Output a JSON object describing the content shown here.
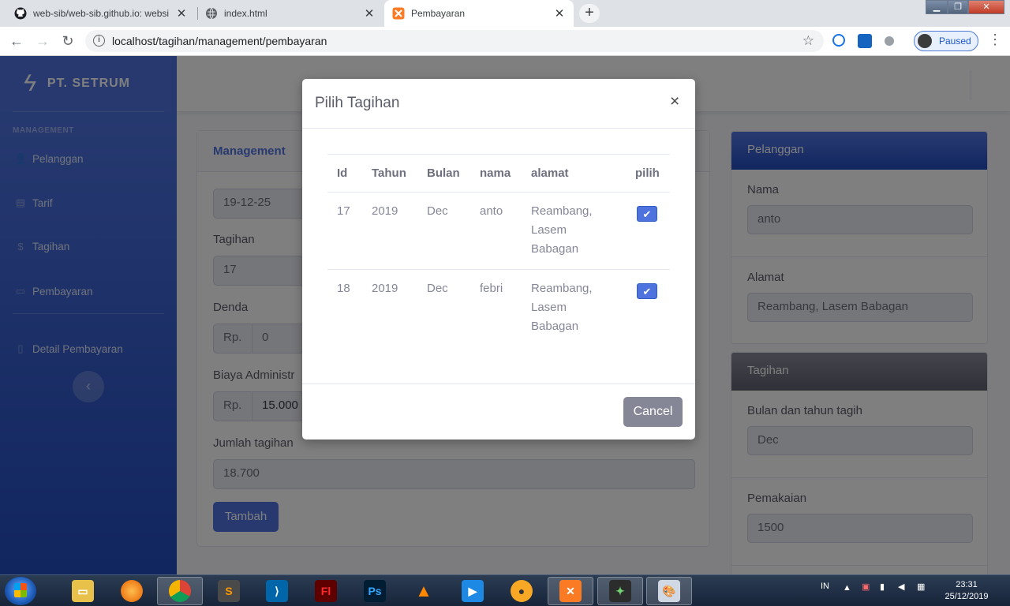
{
  "browser": {
    "tabs": [
      {
        "title": "web-sib/web-sib.github.io: websi",
        "icon": "github-icon"
      },
      {
        "title": "index.html",
        "icon": "globe-icon"
      },
      {
        "title": "Pembayaran",
        "icon": "xampp-icon"
      }
    ],
    "url": "localhost/tagihan/management/pembayaran",
    "profile_status": "Paused"
  },
  "sidebar": {
    "brand": "PT. SETRUM",
    "heading": "MANAGEMENT",
    "items": [
      {
        "label": "Pelanggan",
        "icon": "user-icon"
      },
      {
        "label": "Tarif",
        "icon": "clipboard-icon"
      },
      {
        "label": "Tagihan",
        "icon": "dollar-icon"
      },
      {
        "label": "Pembayaran",
        "icon": "money-icon"
      },
      {
        "label": "Detail Pembayaran",
        "icon": "file-icon"
      }
    ]
  },
  "main_card": {
    "title": "Management",
    "date_value": "19-12-25",
    "tagihan_label": "Tagihan",
    "tagihan_value": "17",
    "denda_label": "Denda",
    "denda_prefix": "Rp.",
    "denda_value": "0",
    "biaya_label": "Biaya Administr",
    "biaya_prefix": "Rp.",
    "biaya_value": "15.000",
    "jumlah_label": "Jumlah tagihan",
    "jumlah_value": "18.700",
    "add_button": "Tambah"
  },
  "pelanggan_card": {
    "title": "Pelanggan",
    "nama_label": "Nama",
    "nama_value": "anto",
    "alamat_label": "Alamat",
    "alamat_value": "Reambang, Lasem Babagan"
  },
  "tagihan_card": {
    "title": "Tagihan",
    "bulan_label": "Bulan dan tahun tagih",
    "bulan_value": "Dec",
    "pemakaian_label": "Pemakaian",
    "pemakaian_value": "1500"
  },
  "modal": {
    "title": "Pilih Tagihan",
    "close": "×",
    "columns": [
      "Id",
      "Tahun",
      "Bulan",
      "nama",
      "alamat",
      "pilih"
    ],
    "rows": [
      {
        "id": "17",
        "tahun": "2019",
        "bulan": "Dec",
        "nama": "anto",
        "alamat": [
          "Reambang,",
          "Lasem",
          "Babagan"
        ],
        "checked": true
      },
      {
        "id": "18",
        "tahun": "2019",
        "bulan": "Dec",
        "nama": "febri",
        "alamat": [
          "Reambang,",
          "Lasem",
          "Babagan"
        ],
        "checked": true
      }
    ],
    "cancel": "Cancel"
  },
  "taskbar": {
    "language": "IN",
    "time": "23:31",
    "date": "25/12/2019"
  }
}
